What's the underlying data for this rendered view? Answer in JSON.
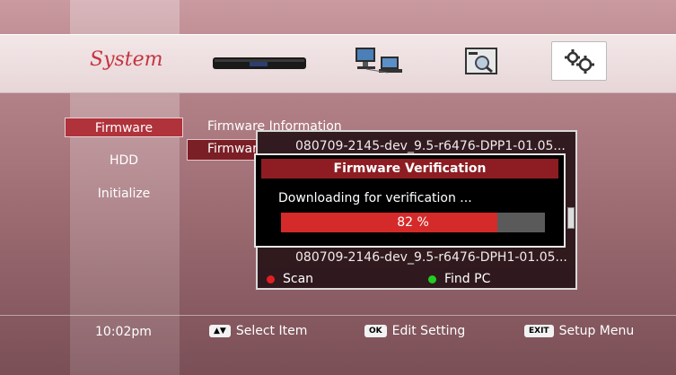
{
  "header": {
    "title": "System",
    "icons": [
      "set-top-box-icon",
      "network-icon",
      "info-card-icon",
      "settings-gears-icon"
    ]
  },
  "menu": {
    "items": [
      {
        "label": "Firmware",
        "selected": true
      },
      {
        "label": "HDD",
        "selected": false
      },
      {
        "label": "Initialize",
        "selected": false
      }
    ]
  },
  "submenu": {
    "item1": "Firmware Information",
    "item2": "Firmwar"
  },
  "firmware_list": {
    "rows": [
      "080709-2145-dev_9.5-r6476-DPP1-01.05...",
      "080709-2146-dev_9.5-r6476-DPH1-01.05..."
    ],
    "buttons": [
      {
        "label": "Scan",
        "color": "#e02020"
      },
      {
        "label": "Find PC",
        "color": "#22cc22"
      }
    ]
  },
  "dialog": {
    "title": "Firmware Verification",
    "message": "Downloading for verification ...",
    "progress": 82,
    "progress_text": "82 %"
  },
  "footer": {
    "time": "10:02pm",
    "hints": [
      {
        "key": "▲▼",
        "label": "Select Item"
      },
      {
        "key": "OK",
        "label": "Edit Setting"
      },
      {
        "key": "EXIT",
        "label": "Setup Menu"
      }
    ]
  },
  "colors": {
    "accent": "#c43440",
    "dialog_title_bg": "#8d1d22",
    "progress_fill": "#d52a2a"
  }
}
